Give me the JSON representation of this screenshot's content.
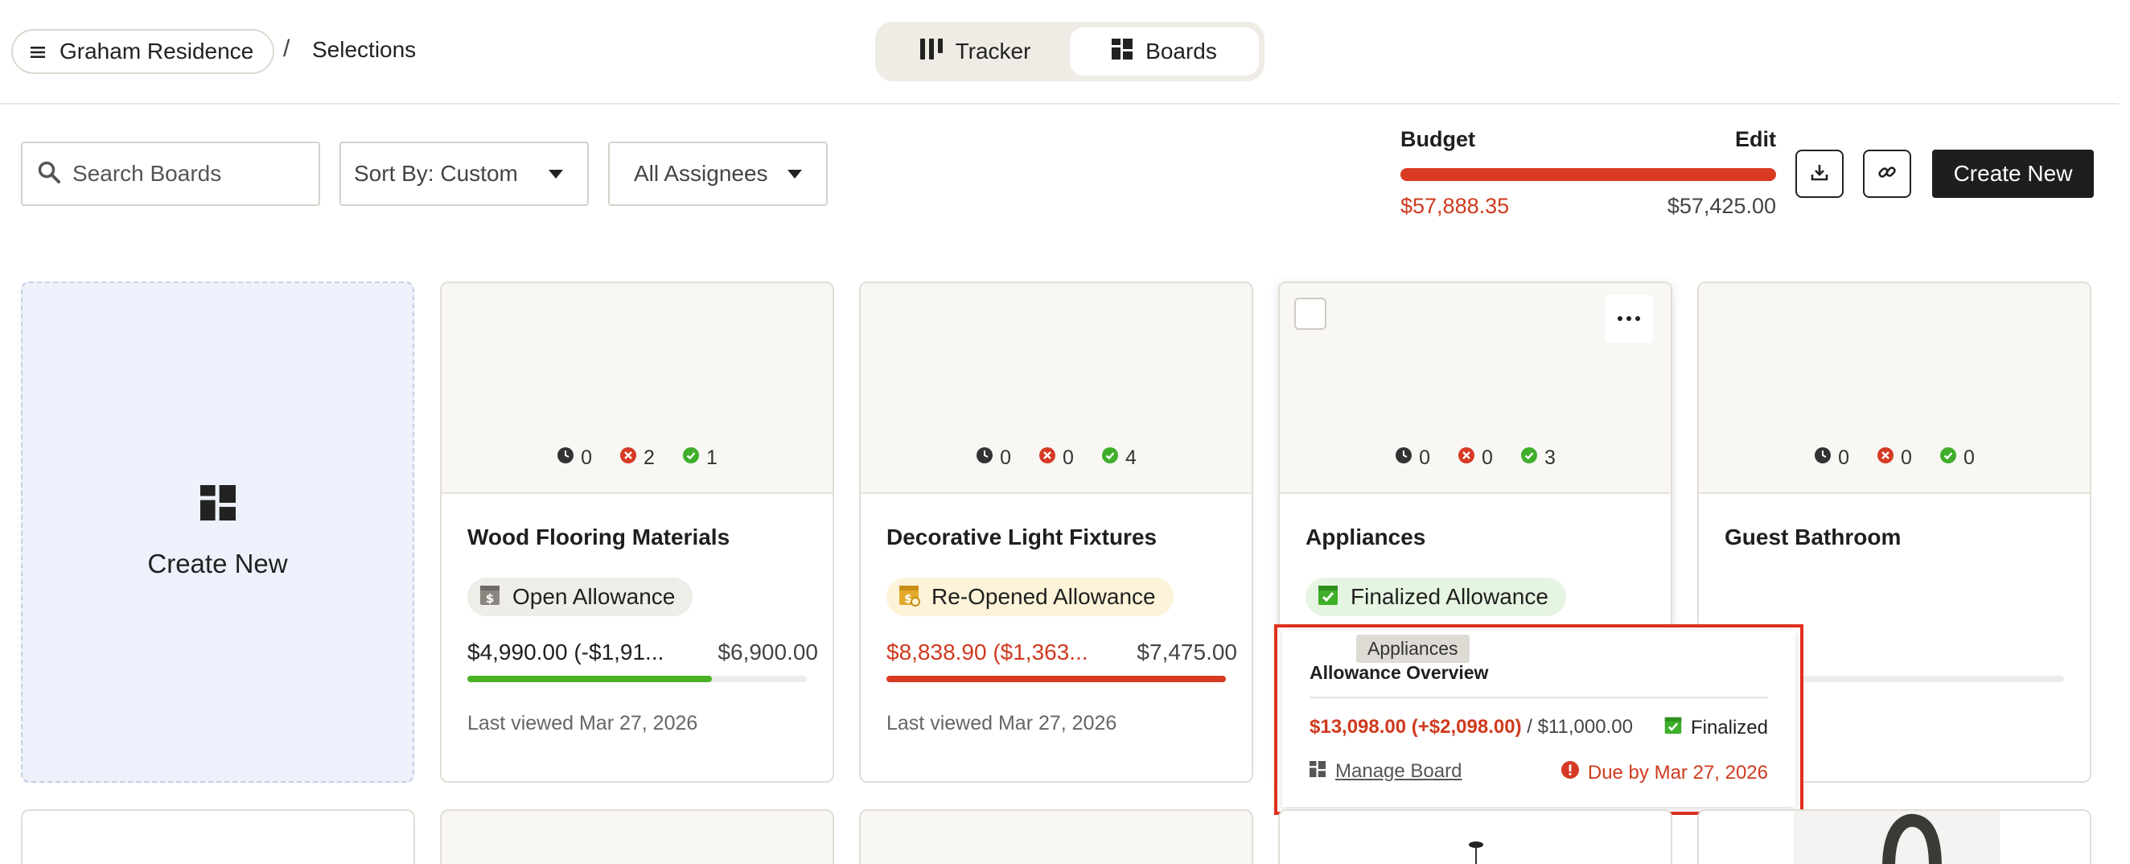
{
  "header": {
    "project_name": "Graham Residence",
    "breadcrumb_separator": "/",
    "current_page": "Selections",
    "view_toggle": [
      {
        "label": "Tracker",
        "icon": "columns-icon",
        "active": false
      },
      {
        "label": "Boards",
        "icon": "boards-icon",
        "active": true
      }
    ]
  },
  "toolbar": {
    "search_placeholder": "Search Boards",
    "sort_label": "Sort By: Custom",
    "assignee_label": "All Assignees",
    "budget": {
      "label": "Budget",
      "edit_label": "Edit",
      "spent": "$57,888.35",
      "total": "$57,425.00",
      "bar_color": "#d93a22",
      "fill_fraction": 1.0
    },
    "download_icon": "download-icon",
    "link_icon": "link-icon",
    "create_label": "Create New"
  },
  "create_card": {
    "label": "Create New"
  },
  "boards": [
    {
      "title": "Wood Flooring Materials",
      "counts": {
        "pending": "0",
        "rejected": "2",
        "approved": "1"
      },
      "status": "Open Allowance",
      "status_style": "open",
      "amount": "$4,990.00 (-$1,91...",
      "allowance": "$6,900.00",
      "amount_color": "#1f1f1f",
      "progress": 0.72,
      "progress_color": "#4cb325",
      "viewed": "Last viewed Mar 27, 2026"
    },
    {
      "title": "Decorative Light Fixtures",
      "counts": {
        "pending": "0",
        "rejected": "0",
        "approved": "4"
      },
      "status": "Re-Opened Allowance",
      "status_style": "reopened",
      "amount": "$8,838.90 ($1,363...",
      "allowance": "$7,475.00",
      "amount_color": "#cf3a1e",
      "progress": 1.0,
      "progress_color": "#d93a22",
      "viewed": "Last viewed Mar 27, 2026"
    },
    {
      "title": "Appliances",
      "counts": {
        "pending": "0",
        "rejected": "0",
        "approved": "3"
      },
      "status": "Finalized Allowance",
      "status_style": "finalized"
    },
    {
      "title": "Guest Bathroom",
      "counts": {
        "pending": "0",
        "rejected": "0",
        "approved": "0"
      }
    }
  ],
  "popover": {
    "tooltip": "Appliances",
    "title": "Allowance Overview",
    "amount": "$13,098.00 (+$2,098.00)",
    "separator": "/",
    "allowance": "$11,000.00",
    "status": "Finalized",
    "manage_label": "Manage Board",
    "due": "Due by Mar 27, 2026"
  }
}
